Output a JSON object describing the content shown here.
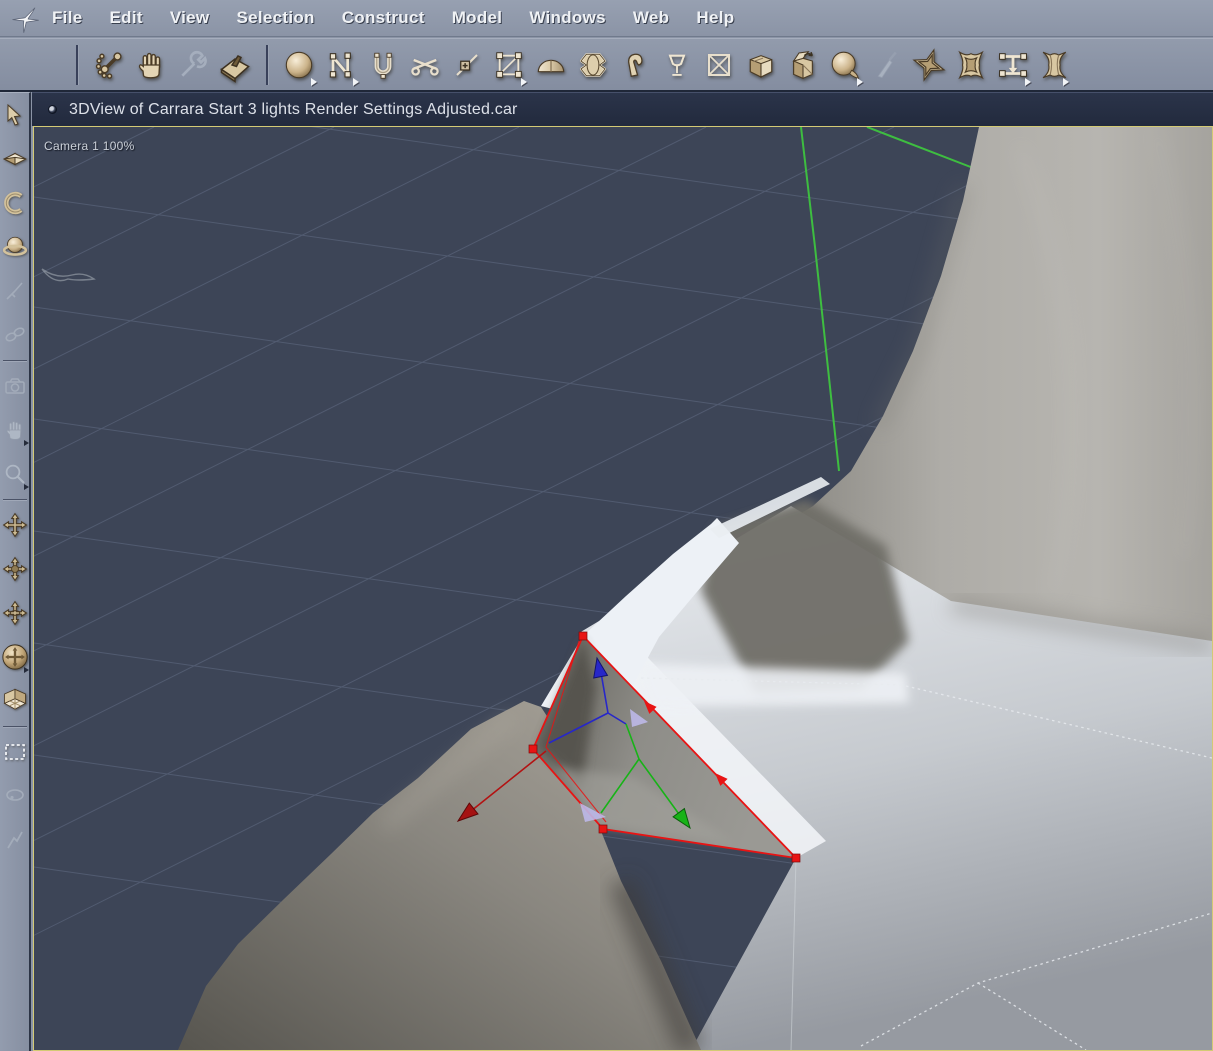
{
  "menubar": {
    "items": [
      "File",
      "Edit",
      "View",
      "Selection",
      "Construct",
      "Model",
      "Windows",
      "Web",
      "Help"
    ]
  },
  "toolbar": {
    "items": [
      {
        "name": "joint-rotate-tool"
      },
      {
        "name": "pan-hand-tool"
      },
      {
        "name": "wrench-tool",
        "disabled": true
      },
      {
        "name": "trowel-smooth-tool"
      },
      {
        "name": "sphere-primitive-tool",
        "flyout": true
      },
      {
        "name": "spline-curve-tool",
        "flyout": true
      },
      {
        "name": "magnet-tool"
      },
      {
        "name": "scissors-cut-tool"
      },
      {
        "name": "pin-add-point-tool"
      },
      {
        "name": "scale-frame-tool",
        "flyout": true
      },
      {
        "name": "dome-tool"
      },
      {
        "name": "lathe-barrel-tool"
      },
      {
        "name": "bend-tube-tool"
      },
      {
        "name": "goblet-lathe-tool"
      },
      {
        "name": "delete-box-tool"
      },
      {
        "name": "cube-primitive-tool"
      },
      {
        "name": "unfold-box-tool"
      },
      {
        "name": "smudge-sphere-tool",
        "flyout": true
      },
      {
        "name": "knife-tool",
        "disabled": true
      },
      {
        "name": "star-extrude-tool"
      },
      {
        "name": "twist-extrude-tool"
      },
      {
        "name": "loft-tool",
        "flyout": true
      },
      {
        "name": "sweep-tool",
        "flyout": true
      }
    ]
  },
  "sidebar": {
    "items": [
      {
        "name": "select-arrow-tool"
      },
      {
        "name": "move-3d-tool"
      },
      {
        "name": "rotate-tool"
      },
      {
        "name": "scale-tool"
      },
      {
        "name": "paint-tool",
        "disabled": true
      },
      {
        "name": "link-tool",
        "disabled": true
      },
      {
        "name": "camera-tool",
        "disabled": true
      },
      {
        "name": "pan-view-tool",
        "disabled": true,
        "flyout": true
      },
      {
        "name": "zoom-view-tool",
        "disabled": true,
        "flyout": true
      },
      {
        "name": "translate-xy-tool"
      },
      {
        "name": "translate-camera-tool"
      },
      {
        "name": "bank-camera-tool"
      },
      {
        "name": "trackball-rotate-tool",
        "selected": true,
        "flyout": true
      },
      {
        "name": "working-box-tool"
      },
      {
        "name": "marquee-select-tool"
      },
      {
        "name": "lasso-select-tool",
        "disabled": true
      },
      {
        "name": "polyline-draw-tool",
        "disabled": true
      }
    ]
  },
  "window": {
    "title": "3DView of Carrara Start 3 lights Render Settings Adjusted.car"
  },
  "viewport": {
    "camera_label": "Camera 1 100%"
  },
  "colors": {
    "chrome": "#8b94a6",
    "titlebar": "#242c40",
    "viewport_background": "#3d4557",
    "viewport_border": "#d3ca74",
    "grid_line": "#66718a",
    "axis_green": "#3ecb3e",
    "selection_red": "#e81414",
    "gizmo_blue": "#2727c9",
    "gizmo_green": "#17b317",
    "icon_tan": "#d8c7a2"
  }
}
